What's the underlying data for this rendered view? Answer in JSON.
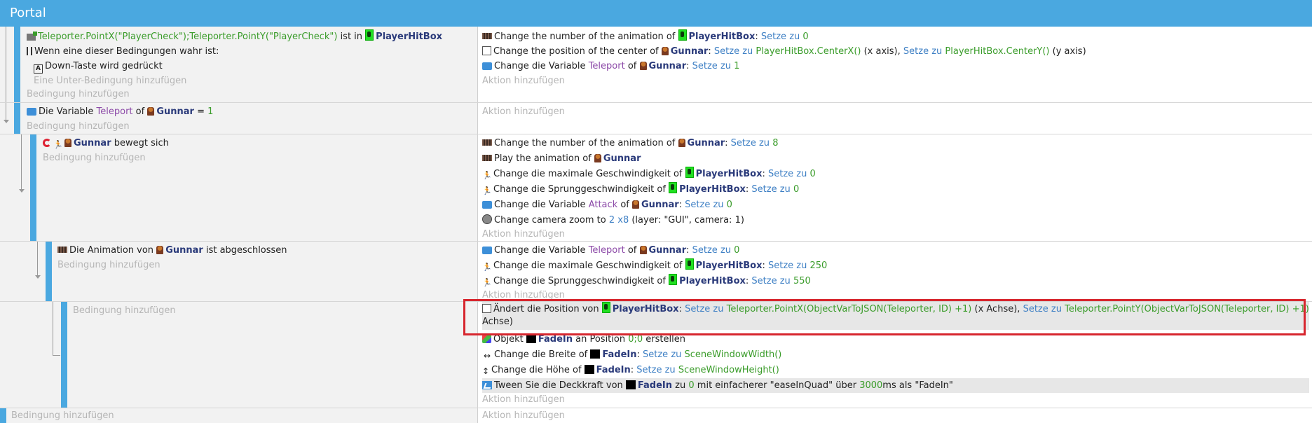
{
  "header": {
    "title": "Portal"
  },
  "common": {
    "add_condition": "Bedingung hinzufügen",
    "add_action": "Aktion hinzufügen",
    "add_subcondition": "Eine Unter-Bedingung hinzufügen"
  },
  "event1": {
    "cond1_expr": "Teleporter.PointX(\"PlayerCheck\");Teleporter.PointY(\"PlayerCheck\")",
    "cond1_mid": "ist in",
    "obj_playerhitbox": "PlayerHitBox",
    "cond2": "Wenn eine dieser Bedingungen wahr ist:",
    "cond3": "Down-Taste wird gedrückt",
    "key_icon_letter": "A",
    "a1_pre": "Change the number of the animation of",
    "a1_set": "Setze zu",
    "a1_val": "0",
    "a2_pre": "Change the position of the center of",
    "obj_gunnar": "Gunnar",
    "a2_set1": "Setze zu",
    "a2_v1": "PlayerHitBox.CenterX()",
    "a2_x": "(x axis),",
    "a2_set2": "Setze zu",
    "a2_v2": "PlayerHitBox.CenterY()",
    "a2_y": "(y axis)",
    "a3_pre": "Change die Variable",
    "a3_var": "Teleport",
    "a3_of": "of",
    "a3_set": "Setze zu",
    "a3_val": "1"
  },
  "event2": {
    "cond_pre": "Die Variable",
    "var": "Teleport",
    "of": "of",
    "obj": "Gunnar",
    "eq": "=",
    "val": "1"
  },
  "event3": {
    "cond_obj": "Gunnar",
    "cond_post": "bewegt sich",
    "a1_pre": "Change the number of the animation of",
    "a1_obj": "Gunnar",
    "a1_set": "Setze zu",
    "a1_val": "8",
    "a2_pre": "Play the animation of",
    "a2_obj": "Gunnar",
    "a3_pre": "Change die maximale Geschwindigkeit of",
    "a3_obj": "PlayerHitBox",
    "a3_set": "Setze zu",
    "a3_val": "0",
    "a4_pre": "Change die Sprunggeschwindigkeit of",
    "a4_obj": "PlayerHitBox",
    "a4_set": "Setze zu",
    "a4_val": "0",
    "a5_pre": "Change die Variable",
    "a5_var": "Attack",
    "a5_of": "of",
    "a5_obj": "Gunnar",
    "a5_set": "Setze zu",
    "a5_val": "0",
    "a6_pre": "Change camera zoom to",
    "a6_val": "2 x8",
    "a6_post": "(layer: \"GUI\", camera: 1)"
  },
  "event4": {
    "cond_pre": "Die Animation von",
    "cond_obj": "Gunnar",
    "cond_post": "ist abgeschlossen",
    "a1_pre": "Change die Variable",
    "a1_var": "Teleport",
    "a1_of": "of",
    "a1_obj": "Gunnar",
    "a1_set": "Setze zu",
    "a1_val": "0",
    "a2_pre": "Change die maximale Geschwindigkeit of",
    "a2_obj": "PlayerHitBox",
    "a2_set": "Setze zu",
    "a2_val": "250",
    "a3_pre": "Change die Sprunggeschwindigkeit of",
    "a3_obj": "PlayerHitBox",
    "a3_set": "Setze zu",
    "a3_val": "550"
  },
  "event5": {
    "a1_pre": "Ändert die Position von",
    "a1_obj": "PlayerHitBox",
    "a1_set1": "Setze zu",
    "a1_v1": "Teleporter.PointX(ObjectVarToJSON(Teleporter, ID) +1)",
    "a1_x": "(x Achse),",
    "a1_set2": "Setze zu",
    "a1_v2": "Teleporter.PointY(ObjectVarToJSON(Teleporter, ID) +1)",
    "a1_y": "(y",
    "a1_y2": "Achse)",
    "a2_pre": "Objekt",
    "a2_obj": "FadeIn",
    "a2_mid": "an Position",
    "a2_val": "0;0",
    "a2_post": "erstellen",
    "a3_pre": "Change die Breite of",
    "a3_obj": "FadeIn",
    "a3_set": "Setze zu",
    "a3_val": "SceneWindowWidth()",
    "a4_pre": "Change die Höhe of",
    "a4_obj": "FadeIn",
    "a4_set": "Setze zu",
    "a4_val": "SceneWindowHeight()",
    "a5_pre": "Tween Sie die Deckkraft von",
    "a5_obj": "FadeIn",
    "a5_mid": "zu",
    "a5_val": "0",
    "a5_mid2": "mit einfacherer \"easeInQuad\" über",
    "a5_ms": "3000",
    "a5_post": "ms als \"FadeIn\""
  },
  "colors": {
    "header": "#4aa8e0",
    "highlight": "#d7262e"
  }
}
